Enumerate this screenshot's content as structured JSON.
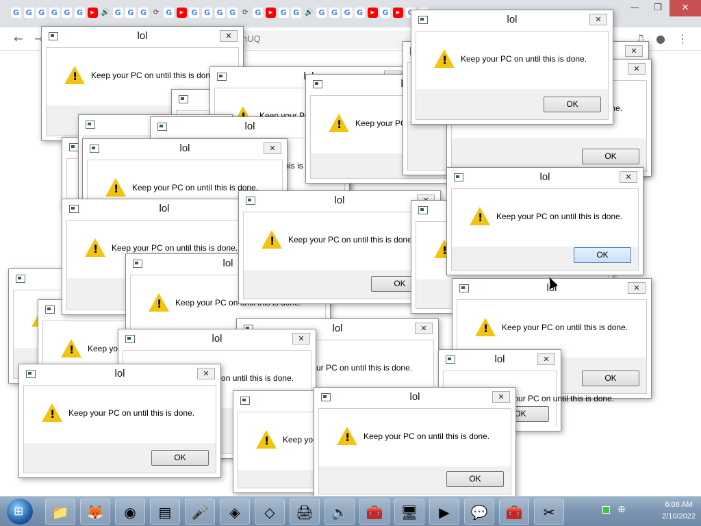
{
  "browser": {
    "tab_icons": [
      "G",
      "G",
      "G",
      "G",
      "G",
      "G",
      "▶",
      "🔊",
      "G",
      "G",
      "G",
      "⟳",
      "G",
      "▶",
      "G",
      "G",
      "G",
      "G",
      "⟳",
      "G",
      "▶",
      "G",
      "G",
      "🔊",
      "G",
      "G",
      "G",
      "G",
      "▶",
      "G",
      "▶",
      "G",
      "G"
    ],
    "omnibox_fragment": "nUQ",
    "window_controls": {
      "minimize": "—",
      "restore": "❐",
      "close": "✕"
    }
  },
  "dialogs": [
    {
      "title": "lol",
      "message": "Keep your PC on until this is done.",
      "ok": "OK"
    }
  ],
  "taskbar": {
    "apps": [
      {
        "name": "explorer",
        "icon": "📁"
      },
      {
        "name": "firefox",
        "icon": "🦊"
      },
      {
        "name": "chrome",
        "icon": "◉"
      },
      {
        "name": "notepad",
        "icon": "▤"
      },
      {
        "name": "microphone",
        "icon": "🎤"
      },
      {
        "name": "cube",
        "icon": "◈"
      },
      {
        "name": "app",
        "icon": "◇"
      },
      {
        "name": "printer",
        "icon": "🖨"
      },
      {
        "name": "speaker",
        "icon": "🔈"
      },
      {
        "name": "toolbox",
        "icon": "🧰"
      },
      {
        "name": "monitor",
        "icon": "🖥"
      },
      {
        "name": "media",
        "icon": "▶"
      },
      {
        "name": "chat",
        "icon": "💬"
      },
      {
        "name": "toolbox2",
        "icon": "🧰"
      },
      {
        "name": "scissors",
        "icon": "✂"
      }
    ],
    "time": "6:06 AM",
    "date": "2/10/2022"
  }
}
